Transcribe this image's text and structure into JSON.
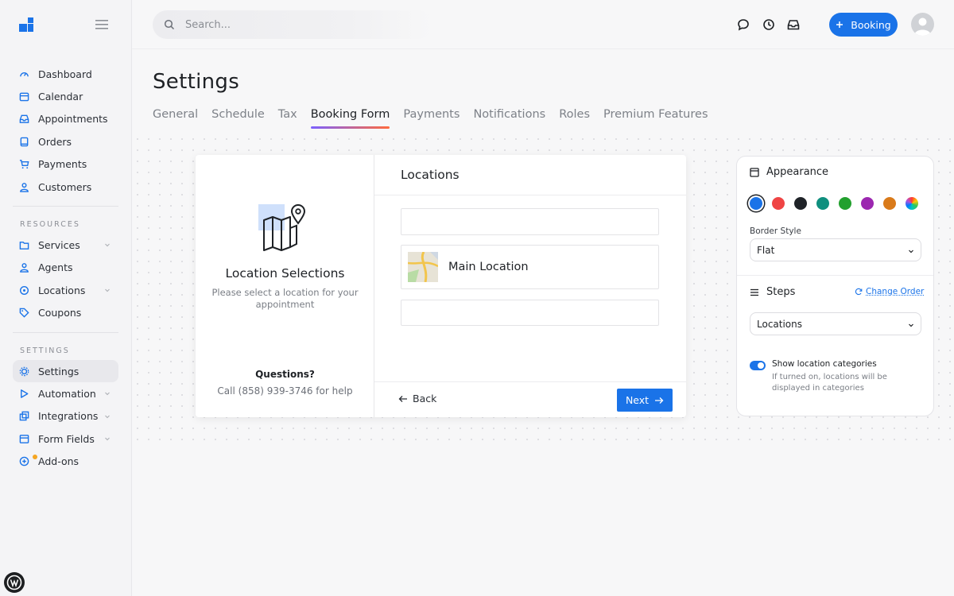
{
  "sidebar": {
    "main_items": [
      {
        "label": "Dashboard",
        "icon": "dashboard-icon"
      },
      {
        "label": "Calendar",
        "icon": "calendar-icon"
      },
      {
        "label": "Appointments",
        "icon": "inbox-icon"
      },
      {
        "label": "Orders",
        "icon": "tablet-icon"
      },
      {
        "label": "Payments",
        "icon": "cart-icon"
      },
      {
        "label": "Customers",
        "icon": "user-icon"
      }
    ],
    "resources_title": "RESOURCES",
    "resources_items": [
      {
        "label": "Services",
        "icon": "folder-icon"
      },
      {
        "label": "Agents",
        "icon": "user-icon"
      },
      {
        "label": "Locations",
        "icon": "pin-icon"
      },
      {
        "label": "Coupons",
        "icon": "tag-icon"
      }
    ],
    "settings_title": "SETTINGS",
    "settings_items": [
      {
        "label": "Settings",
        "icon": "gear-icon"
      },
      {
        "label": "Automation",
        "icon": "play-icon"
      },
      {
        "label": "Integrations",
        "icon": "integrations-icon"
      },
      {
        "label": "Form Fields",
        "icon": "form-icon"
      },
      {
        "label": "Add-ons",
        "icon": "plus-circle-icon"
      }
    ]
  },
  "topbar": {
    "search_placeholder": "Search...",
    "booking_label": "Booking"
  },
  "page": {
    "title": "Settings",
    "tabs": [
      "General",
      "Schedule",
      "Tax",
      "Booking Form",
      "Payments",
      "Notifications",
      "Roles",
      "Premium Features"
    ],
    "active_tab": "Booking Form"
  },
  "preview": {
    "left_title": "Location Selections",
    "left_subtitle": "Please select a location for your appointment",
    "questions_label": "Questions?",
    "phone_text": "Call (858) 939-3746 for help",
    "right_title": "Locations",
    "location_name": "Main Location",
    "back_label": "Back",
    "next_label": "Next"
  },
  "panel": {
    "appearance_title": "Appearance",
    "colors": [
      "#1a73e8",
      "#ef4444",
      "#1f2328",
      "#0f8f7e",
      "#22a02e",
      "#9c27b0",
      "#d97a1a",
      "rainbow"
    ],
    "selected_color": "#1a73e8",
    "border_style_label": "Border Style",
    "border_style_value": "Flat",
    "steps_title": "Steps",
    "change_order_label": "Change Order",
    "steps_value": "Locations",
    "toggle_label": "Show location categories",
    "toggle_help": "If turned on, locations will be displayed in categories",
    "toggle_on": true
  }
}
